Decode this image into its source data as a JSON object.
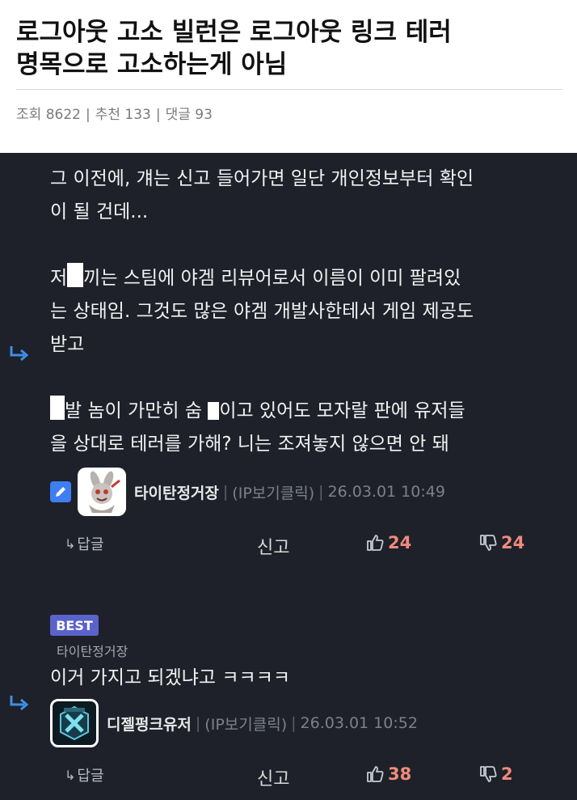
{
  "post": {
    "title_line1": "로그아웃 고소 빌런은 로그아웃 링크 테러",
    "title_line2": "명목으로 고소하는게 아님",
    "stats": {
      "views_label": "조회",
      "views": "8622",
      "recommend_label": "추천",
      "recommend": "133",
      "comments_label": "댓글",
      "comments": "93"
    }
  },
  "comment1": {
    "lines": [
      "그 이전에, 걔는 신고 들어가면 일단 개인정보부터 확인",
      "이 될 건데...",
      "",
      "저[ ]끼는 스팀에 야겜 리뷰어로서 이름이 이미 팔려있",
      "는 상태임. 그것도 많은 야겜 개발사한테서 게임 제공도",
      "받고",
      "",
      "[ ]발 놈이 가만히 숨 [ ]이고 있어도 모자랄 판에 유저들",
      "을 상대로 테러를 가해? 니는 조져놓지 않으면 안 돼"
    ],
    "author": "타이탄정거장",
    "ip": "(IP보기클릭)",
    "date": "26.03.01 10:49",
    "reply_label": "답글",
    "report_label": "신고",
    "upvotes": "24",
    "downvotes": "24",
    "avatar_icon": "cartoon-bunny-avatar"
  },
  "comment2": {
    "badge": "BEST",
    "reply_to": "타이탄정거장",
    "text": "이거 가지고 되겠냐고 ㅋㅋㅋㅋ",
    "author": "디젤펑크유저",
    "ip": "(IP보기클릭)",
    "date": "26.03.01 10:52",
    "reply_label": "답글",
    "report_label": "신고",
    "upvotes": "38",
    "downvotes": "2",
    "avatar_icon": "xcom-emblem-avatar"
  },
  "colors": {
    "background_dark": "#1e2129",
    "vote_count": "#f08a7c",
    "reply_arrow": "#3d8fe8",
    "best_badge": "#5a63c9"
  }
}
